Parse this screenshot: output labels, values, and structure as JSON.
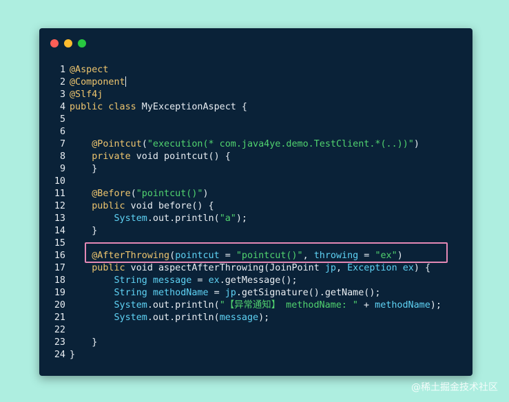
{
  "window": {
    "colors": {
      "background": "#0a2238",
      "page": "#aeeee0"
    }
  },
  "code": {
    "lines": [
      {
        "n": "1",
        "tokens": [
          [
            "ann",
            "@Aspect"
          ]
        ]
      },
      {
        "n": "2",
        "tokens": [
          [
            "ann",
            "@Component"
          ]
        ],
        "caret": true
      },
      {
        "n": "3",
        "tokens": [
          [
            "ann",
            "@Slf4j"
          ]
        ]
      },
      {
        "n": "4",
        "tokens": [
          [
            "kw",
            "public class"
          ],
          [
            "pl",
            " MyExceptionAspect {"
          ]
        ]
      },
      {
        "n": "5",
        "tokens": []
      },
      {
        "n": "6",
        "tokens": []
      },
      {
        "n": "7",
        "tokens": [
          [
            "pl",
            "    "
          ],
          [
            "ann",
            "@Pointcut"
          ],
          [
            "pl",
            "("
          ],
          [
            "str",
            "\"execution(* com.java4ye.demo.TestClient.*(..))\""
          ],
          [
            "pl",
            ")"
          ]
        ]
      },
      {
        "n": "8",
        "tokens": [
          [
            "pl",
            "    "
          ],
          [
            "kw",
            "private"
          ],
          [
            "pl",
            " void pointcut() {"
          ]
        ]
      },
      {
        "n": "9",
        "tokens": [
          [
            "pl",
            "    }"
          ]
        ]
      },
      {
        "n": "10",
        "tokens": []
      },
      {
        "n": "11",
        "tokens": [
          [
            "pl",
            "    "
          ],
          [
            "ann",
            "@Before"
          ],
          [
            "pl",
            "("
          ],
          [
            "str",
            "\"pointcut()\""
          ],
          [
            "pl",
            ")"
          ]
        ]
      },
      {
        "n": "12",
        "tokens": [
          [
            "pl",
            "    "
          ],
          [
            "kw",
            "public"
          ],
          [
            "pl",
            " void before() {"
          ]
        ]
      },
      {
        "n": "13",
        "tokens": [
          [
            "pl",
            "        "
          ],
          [
            "id",
            "System"
          ],
          [
            "pl",
            ".out.println("
          ],
          [
            "str",
            "\"a\""
          ],
          [
            "pl",
            ");"
          ]
        ]
      },
      {
        "n": "14",
        "tokens": [
          [
            "pl",
            "    }"
          ]
        ]
      },
      {
        "n": "15",
        "tokens": []
      },
      {
        "n": "16",
        "tokens": [
          [
            "pl",
            "    "
          ],
          [
            "ann",
            "@AfterThrowing"
          ],
          [
            "pl",
            "("
          ],
          [
            "id",
            "pointcut"
          ],
          [
            "pl",
            " = "
          ],
          [
            "str",
            "\"pointcut()\""
          ],
          [
            "pl",
            ", "
          ],
          [
            "id",
            "throwing"
          ],
          [
            "pl",
            " = "
          ],
          [
            "str",
            "\"ex\""
          ],
          [
            "pl",
            ")"
          ]
        ]
      },
      {
        "n": "17",
        "tokens": [
          [
            "pl",
            "    "
          ],
          [
            "kw",
            "public"
          ],
          [
            "pl",
            " void aspectAfterThrowing(JoinPoint "
          ],
          [
            "id",
            "jp"
          ],
          [
            "pl",
            ", "
          ],
          [
            "id",
            "Exception"
          ],
          [
            "pl",
            " "
          ],
          [
            "id",
            "ex"
          ],
          [
            "pl",
            ") {"
          ]
        ]
      },
      {
        "n": "18",
        "tokens": [
          [
            "pl",
            "        "
          ],
          [
            "id",
            "String"
          ],
          [
            "pl",
            " "
          ],
          [
            "id",
            "message"
          ],
          [
            "pl",
            " = "
          ],
          [
            "id",
            "ex"
          ],
          [
            "pl",
            ".getMessage();"
          ]
        ]
      },
      {
        "n": "19",
        "tokens": [
          [
            "pl",
            "        "
          ],
          [
            "id",
            "String"
          ],
          [
            "pl",
            " "
          ],
          [
            "id",
            "methodName"
          ],
          [
            "pl",
            " = "
          ],
          [
            "id",
            "jp"
          ],
          [
            "pl",
            ".getSignature().getName();"
          ]
        ]
      },
      {
        "n": "20",
        "tokens": [
          [
            "pl",
            "        "
          ],
          [
            "id",
            "System"
          ],
          [
            "pl",
            ".out.println("
          ],
          [
            "str",
            "\"【异常通知】 methodName: \""
          ],
          [
            "pl",
            " + "
          ],
          [
            "id",
            "methodName"
          ],
          [
            "pl",
            ");"
          ]
        ]
      },
      {
        "n": "21",
        "tokens": [
          [
            "pl",
            "        "
          ],
          [
            "id",
            "System"
          ],
          [
            "pl",
            ".out.println("
          ],
          [
            "id",
            "message"
          ],
          [
            "pl",
            ");"
          ]
        ]
      },
      {
        "n": "22",
        "tokens": []
      },
      {
        "n": "23",
        "tokens": [
          [
            "pl",
            "    }"
          ]
        ]
      },
      {
        "n": "24",
        "tokens": [
          [
            "pl",
            "}"
          ]
        ]
      }
    ]
  },
  "watermark": "@稀土掘金技术社区"
}
